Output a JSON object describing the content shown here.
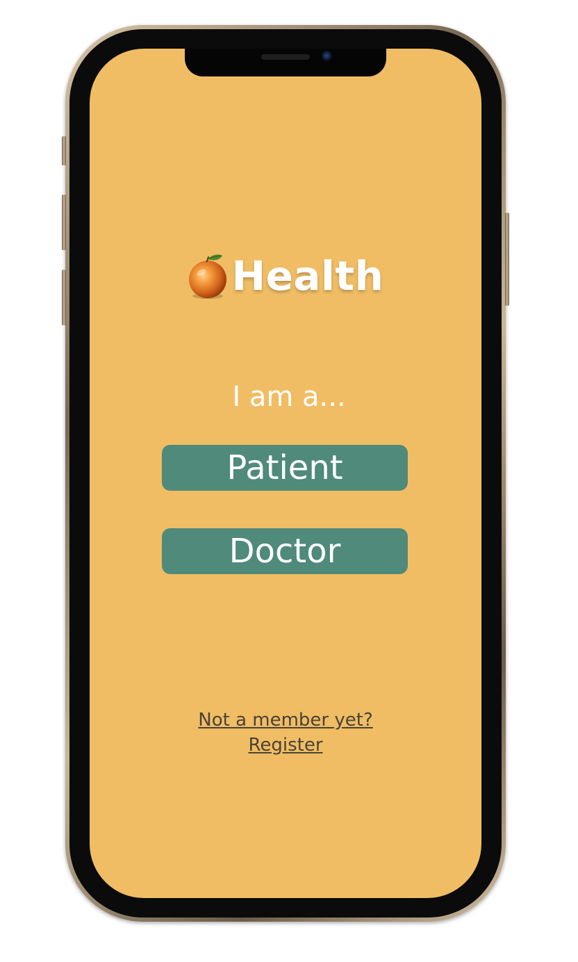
{
  "app": {
    "title": "Health",
    "logo_icon": "orange-icon"
  },
  "main": {
    "prompt": "I am a...",
    "roles": [
      {
        "label": "Patient"
      },
      {
        "label": "Doctor"
      }
    ]
  },
  "footer": {
    "register_line1": "Not a member yet?",
    "register_line2": "Register"
  },
  "colors": {
    "background": "#f0bd64",
    "button": "#4f8a7b",
    "text": "#ffffff",
    "link": "#4a4238"
  }
}
